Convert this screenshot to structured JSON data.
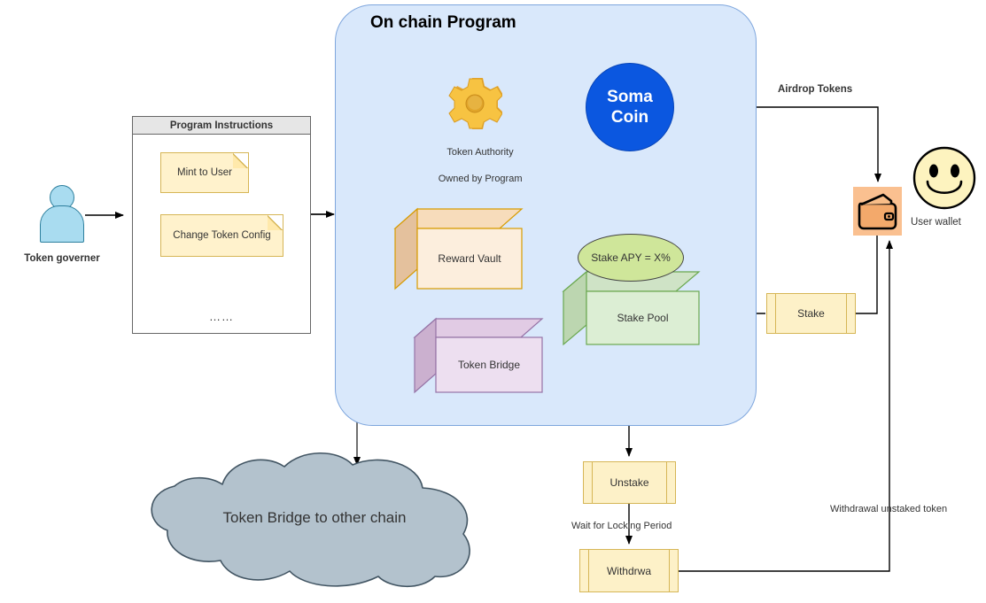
{
  "diagram": {
    "title": "On chain Program",
    "type": "architecture-flow-diagram"
  },
  "onchain_program": {
    "title": "On chain Program",
    "token_authority": {
      "icon": "gear-icon",
      "label_line1": "Token Authority",
      "label_line2": "Owned by Program"
    },
    "soma_coin": {
      "line1": "Soma",
      "line2": "Coin",
      "color": "#0b57e0",
      "text_color": "#ffffff"
    },
    "reward_vault": {
      "label": "Reward Vault",
      "fill": "#fbe0c0",
      "stroke": "#d79b00"
    },
    "token_bridge": {
      "label": "Token Bridge",
      "fill": "#e6d0e8",
      "stroke": "#9673a6"
    },
    "stake_pool": {
      "label": "Stake Pool",
      "fill": "#d9ead3",
      "stroke": "#6aa84f"
    },
    "stake_apy": {
      "label": "Stake APY = X%",
      "fill": "#cfe69a",
      "stroke": "#444444"
    }
  },
  "program_instructions": {
    "header": "Program Instructions",
    "items": [
      {
        "label": "Mint to User"
      },
      {
        "label": "Change Token Config"
      }
    ],
    "ellipsis": "……",
    "note_fill": "#fff2cc",
    "note_stroke": "#d6b656"
  },
  "actors": {
    "token_governer": {
      "label": "Token governer",
      "icon": "user-actor-icon",
      "fill": "#a9dcf0",
      "stroke": "#2d7f9d"
    },
    "user_wallet": {
      "label": "User wallet",
      "wallet_icon": "wallet-icon",
      "face_icon": "smiley-face-icon",
      "wallet_fill": "#fac090",
      "face_fill": "#fdf3bf"
    }
  },
  "processes": {
    "stake": {
      "label": "Stake"
    },
    "unstake": {
      "label": "Unstake"
    },
    "withdraw": {
      "label": "Withdrwa"
    },
    "fill": "#fdf1c8",
    "stroke": "#d6b656"
  },
  "cloud": {
    "label": "Token Bridge to other chain",
    "fill": "#b3c2cd",
    "stroke": "#425563"
  },
  "edge_labels": {
    "airdrop": "Airdrop Tokens",
    "wait_locking": "Wait for Locking Period",
    "withdrawal": "Withdrawal unstaked token"
  }
}
